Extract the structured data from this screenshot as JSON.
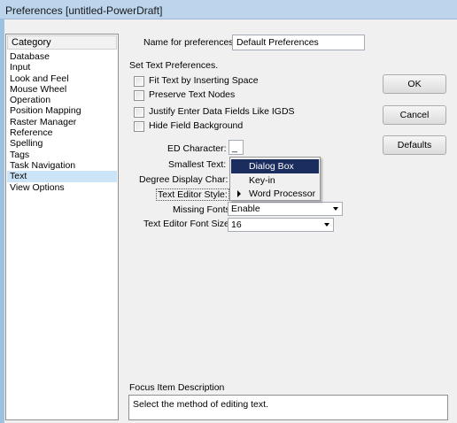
{
  "window": {
    "title": "Preferences [untitled-PowerDraft]"
  },
  "categories": {
    "header": "Category",
    "items": [
      {
        "label": "Database"
      },
      {
        "label": "Input"
      },
      {
        "label": "Look and Feel"
      },
      {
        "label": "Mouse Wheel"
      },
      {
        "label": "Operation"
      },
      {
        "label": "Position Mapping"
      },
      {
        "label": "Raster Manager"
      },
      {
        "label": "Reference"
      },
      {
        "label": "Spelling"
      },
      {
        "label": "Tags"
      },
      {
        "label": "Task Navigation"
      },
      {
        "label": "Text",
        "selected": true
      },
      {
        "label": "View Options"
      }
    ]
  },
  "prefs": {
    "name_label": "Name for preferences",
    "name_value": "Default Preferences",
    "section_label": "Set Text Preferences.",
    "checkboxes": [
      {
        "label": "Fit Text by Inserting Space",
        "checked": false
      },
      {
        "label": "Preserve Text Nodes",
        "checked": false
      },
      {
        "label": "Justify Enter Data Fields Like IGDS",
        "checked": false
      },
      {
        "label": "Hide Field Background",
        "checked": false
      }
    ],
    "ed_char_label": "ED Character:",
    "ed_char_value": "_",
    "smallest_text_label": "Smallest Text:",
    "degree_char_label": "Degree Display Char:",
    "text_editor_style_label": "Text Editor Style:",
    "missing_fonts_label": "Missing Fonts:",
    "missing_fonts_value": "Enable",
    "font_size_label": "Text Editor Font Size",
    "font_size_value": "16"
  },
  "popup_menu": {
    "items": [
      {
        "label": "Dialog Box",
        "highlighted": true
      },
      {
        "label": "Key-in"
      },
      {
        "label": "Word Processor",
        "marked": true
      }
    ]
  },
  "buttons": {
    "ok": "OK",
    "cancel": "Cancel",
    "defaults": "Defaults"
  },
  "focus": {
    "label": "Focus Item Description",
    "description": "Select the method of editing text."
  },
  "colors": {
    "selection": "#cce4f7",
    "menu_highlight": "#1a2d5e",
    "titlebar": "#bcd4ec"
  }
}
